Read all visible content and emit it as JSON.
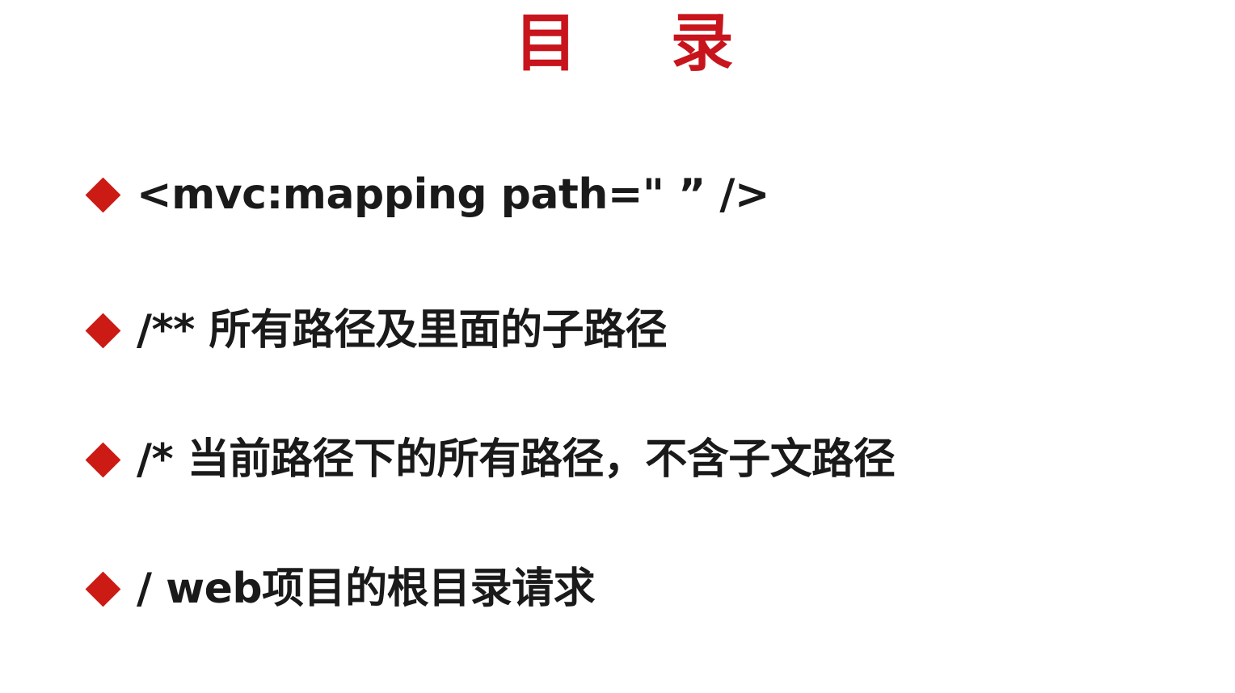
{
  "slide": {
    "title": "目 录",
    "bullets": [
      {
        "text": "<mvc:mapping path=\" ” />"
      },
      {
        "text": "/** 所有路径及里面的子路径"
      },
      {
        "text": "/* 当前路径下的所有路径，不含子文路径"
      },
      {
        "text": "/ web项目的根目录请求"
      }
    ]
  },
  "colors": {
    "title": "#c8141c",
    "bullet_marker": "#cc1a14",
    "text": "#1a1a1a",
    "background": "#ffffff"
  },
  "icons": {
    "bullet_marker": "diamond"
  }
}
